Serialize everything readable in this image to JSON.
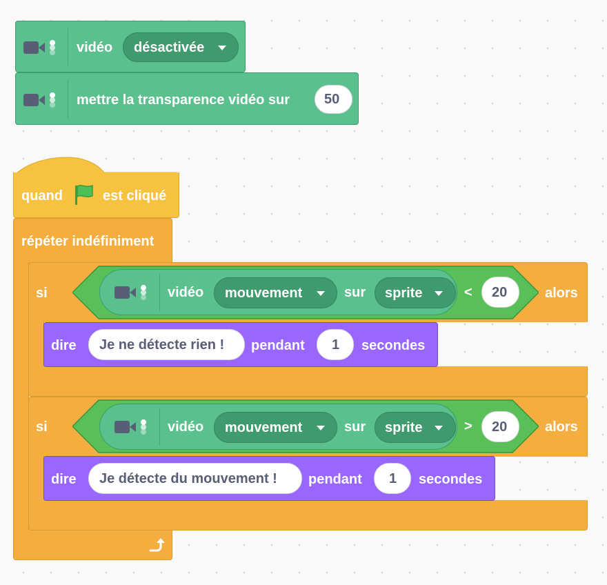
{
  "blocks": {
    "video_toggle": {
      "label": "vidéo",
      "value": "désactivée"
    },
    "transparency": {
      "label": "mettre la transparence vidéo sur",
      "value": "50"
    },
    "hat": {
      "when": "quand",
      "clicked": "est cliqué"
    },
    "forever": {
      "label": "répéter indéfiniment"
    },
    "if1": {
      "si": "si",
      "video": "vidéo",
      "motion": "mouvement",
      "on": "sur",
      "target": "sprite",
      "operator": "<",
      "value": "20",
      "then": "alors",
      "say": {
        "label": "dire",
        "text": "Je ne détecte rien !",
        "for": "pendant",
        "secs": "1",
        "unit": "secondes"
      }
    },
    "if2": {
      "si": "si",
      "video": "vidéo",
      "motion": "mouvement",
      "on": "sur",
      "target": "sprite",
      "operator": ">",
      "value": "20",
      "then": "alors",
      "say": {
        "label": "dire",
        "text": "Je détecte du mouvement !",
        "for": "pendant",
        "secs": "1",
        "unit": "secondes"
      }
    }
  },
  "icons": [
    "video-camera-icon",
    "green-flag-icon",
    "dropdown-caret-icon",
    "loop-arrow-icon"
  ],
  "colors": {
    "extension_green": "#59c08e",
    "control_orange": "#f4ae3f",
    "events_yellow": "#f7c23f",
    "looks_purple": "#9966ff",
    "operator_green": "#59c059"
  }
}
